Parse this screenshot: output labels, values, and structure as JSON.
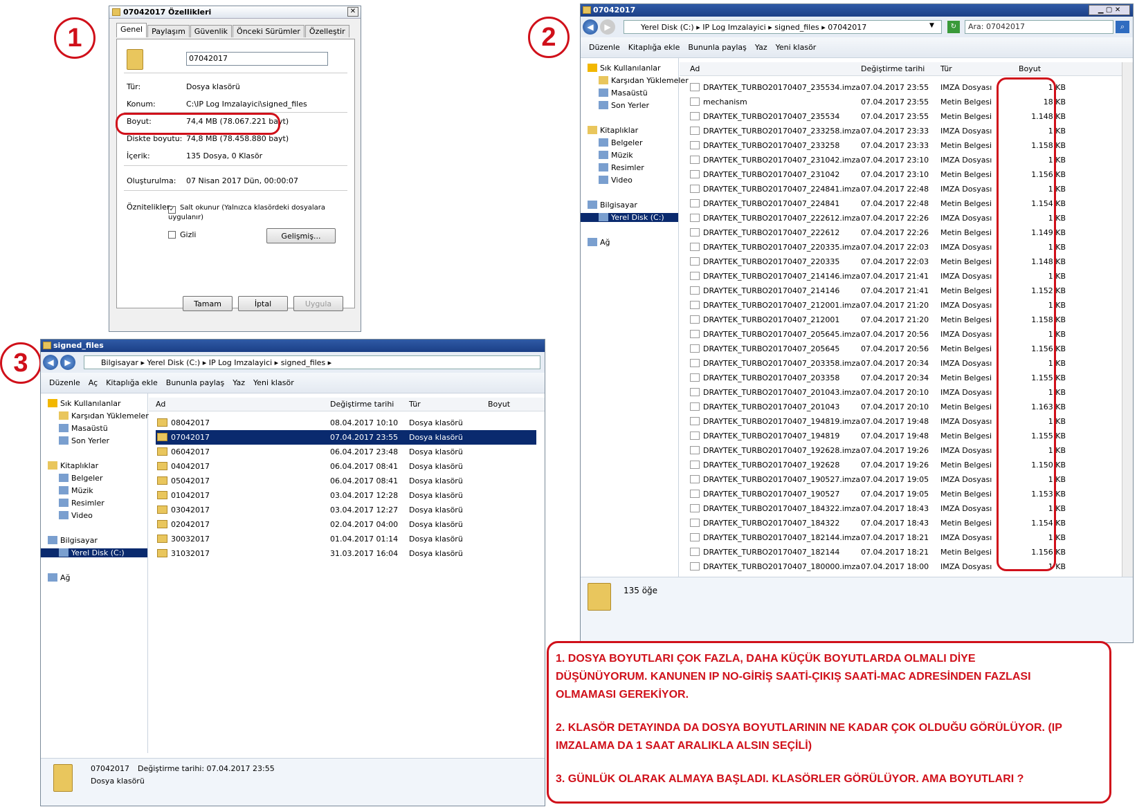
{
  "markers": [
    "1",
    "2",
    "3"
  ],
  "dialog": {
    "title": "07042017 Özellikleri",
    "tabs": [
      "Genel",
      "Paylaşım",
      "Güvenlik",
      "Önceki Sürümler",
      "Özelleştir"
    ],
    "name_value": "07042017",
    "props": [
      {
        "label": "Tür:",
        "value": "Dosya klasörü"
      },
      {
        "label": "Konum:",
        "value": "C:\\IP Log Imzalayici\\signed_files"
      },
      {
        "label": "Boyut:",
        "value": "74,4 MB (78.067.221 bayt)"
      },
      {
        "label": "Diskte boyutu:",
        "value": "74,8 MB (78.458.880 bayt)"
      },
      {
        "label": "İçerik:",
        "value": "135 Dosya, 0 Klasör"
      },
      {
        "label": "Oluşturulma:",
        "value": "07 Nisan 2017 Dün, 00:00:07"
      }
    ],
    "attributes_label": "Öznitelikler:",
    "readonly_label": "Salt okunur (Yalnızca klasördeki dosyalara uygulanır)",
    "hidden_label": "Gizli",
    "advanced_btn": "Gelişmiş...",
    "ok_btn": "Tamam",
    "cancel_btn": "İptal",
    "apply_btn": "Uygula"
  },
  "win2": {
    "title": "07042017",
    "path": [
      "Yerel Disk (C:)",
      "IP Log Imzalayici",
      "signed_files",
      "07042017"
    ],
    "search": "Ara: 07042017",
    "toolbar": [
      "Düzenle",
      "Kitaplığa ekle",
      "Bununla paylaş",
      "Yaz",
      "Yeni klasör"
    ],
    "nav": [
      "Sık Kullanılanlar",
      "Karşıdan Yüklemeler",
      "Masaüstü",
      "Son Yerler",
      "Kitaplıklar",
      "Belgeler",
      "Müzik",
      "Resimler",
      "Video",
      "Bilgisayar",
      "Yerel Disk (C:)",
      "Ağ"
    ],
    "columns": [
      "Ad",
      "Değiştirme tarihi",
      "Tür",
      "Boyut"
    ],
    "rows": [
      [
        "DRAYTEK_TURBO20170407_235534.imza",
        "07.04.2017 23:55",
        "IMZA Dosyası",
        "1 KB"
      ],
      [
        "mechanism",
        "07.04.2017 23:55",
        "Metin Belgesi",
        "18 KB"
      ],
      [
        "DRAYTEK_TURBO20170407_235534",
        "07.04.2017 23:55",
        "Metin Belgesi",
        "1.148 KB"
      ],
      [
        "DRAYTEK_TURBO20170407_233258.imza",
        "07.04.2017 23:33",
        "IMZA Dosyası",
        "1 KB"
      ],
      [
        "DRAYTEK_TURBO20170407_233258",
        "07.04.2017 23:33",
        "Metin Belgesi",
        "1.158 KB"
      ],
      [
        "DRAYTEK_TURBO20170407_231042.imza",
        "07.04.2017 23:10",
        "IMZA Dosyası",
        "1 KB"
      ],
      [
        "DRAYTEK_TURBO20170407_231042",
        "07.04.2017 23:10",
        "Metin Belgesi",
        "1.156 KB"
      ],
      [
        "DRAYTEK_TURBO20170407_224841.imza",
        "07.04.2017 22:48",
        "IMZA Dosyası",
        "1 KB"
      ],
      [
        "DRAYTEK_TURBO20170407_224841",
        "07.04.2017 22:48",
        "Metin Belgesi",
        "1.154 KB"
      ],
      [
        "DRAYTEK_TURBO20170407_222612.imza",
        "07.04.2017 22:26",
        "IMZA Dosyası",
        "1 KB"
      ],
      [
        "DRAYTEK_TURBO20170407_222612",
        "07.04.2017 22:26",
        "Metin Belgesi",
        "1.149 KB"
      ],
      [
        "DRAYTEK_TURBO20170407_220335.imza",
        "07.04.2017 22:03",
        "IMZA Dosyası",
        "1 KB"
      ],
      [
        "DRAYTEK_TURBO20170407_220335",
        "07.04.2017 22:03",
        "Metin Belgesi",
        "1.148 KB"
      ],
      [
        "DRAYTEK_TURBO20170407_214146.imza",
        "07.04.2017 21:41",
        "IMZA Dosyası",
        "1 KB"
      ],
      [
        "DRAYTEK_TURBO20170407_214146",
        "07.04.2017 21:41",
        "Metin Belgesi",
        "1.152 KB"
      ],
      [
        "DRAYTEK_TURBO20170407_212001.imza",
        "07.04.2017 21:20",
        "IMZA Dosyası",
        "1 KB"
      ],
      [
        "DRAYTEK_TURBO20170407_212001",
        "07.04.2017 21:20",
        "Metin Belgesi",
        "1.158 KB"
      ],
      [
        "DRAYTEK_TURBO20170407_205645.imza",
        "07.04.2017 20:56",
        "IMZA Dosyası",
        "1 KB"
      ],
      [
        "DRAYTEK_TURBO20170407_205645",
        "07.04.2017 20:56",
        "Metin Belgesi",
        "1.156 KB"
      ],
      [
        "DRAYTEK_TURBO20170407_203358.imza",
        "07.04.2017 20:34",
        "IMZA Dosyası",
        "1 KB"
      ],
      [
        "DRAYTEK_TURBO20170407_203358",
        "07.04.2017 20:34",
        "Metin Belgesi",
        "1.155 KB"
      ],
      [
        "DRAYTEK_TURBO20170407_201043.imza",
        "07.04.2017 20:10",
        "IMZA Dosyası",
        "1 KB"
      ],
      [
        "DRAYTEK_TURBO20170407_201043",
        "07.04.2017 20:10",
        "Metin Belgesi",
        "1.163 KB"
      ],
      [
        "DRAYTEK_TURBO20170407_194819.imza",
        "07.04.2017 19:48",
        "IMZA Dosyası",
        "1 KB"
      ],
      [
        "DRAYTEK_TURBO20170407_194819",
        "07.04.2017 19:48",
        "Metin Belgesi",
        "1.155 KB"
      ],
      [
        "DRAYTEK_TURBO20170407_192628.imza",
        "07.04.2017 19:26",
        "IMZA Dosyası",
        "1 KB"
      ],
      [
        "DRAYTEK_TURBO20170407_192628",
        "07.04.2017 19:26",
        "Metin Belgesi",
        "1.150 KB"
      ],
      [
        "DRAYTEK_TURBO20170407_190527.imza",
        "07.04.2017 19:05",
        "IMZA Dosyası",
        "1 KB"
      ],
      [
        "DRAYTEK_TURBO20170407_190527",
        "07.04.2017 19:05",
        "Metin Belgesi",
        "1.153 KB"
      ],
      [
        "DRAYTEK_TURBO20170407_184322.imza",
        "07.04.2017 18:43",
        "IMZA Dosyası",
        "1 KB"
      ],
      [
        "DRAYTEK_TURBO20170407_184322",
        "07.04.2017 18:43",
        "Metin Belgesi",
        "1.154 KB"
      ],
      [
        "DRAYTEK_TURBO20170407_182144.imza",
        "07.04.2017 18:21",
        "IMZA Dosyası",
        "1 KB"
      ],
      [
        "DRAYTEK_TURBO20170407_182144",
        "07.04.2017 18:21",
        "Metin Belgesi",
        "1.156 KB"
      ],
      [
        "DRAYTEK_TURBO20170407_180000.imza",
        "07.04.2017 18:00",
        "IMZA Dosyası",
        "1 KB"
      ]
    ],
    "status": "135 öğe"
  },
  "win3": {
    "title": "signed_files",
    "path": [
      "Bilgisayar",
      "Yerel Disk (C:)",
      "IP Log Imzalayici",
      "signed_files"
    ],
    "toolbar": [
      "Düzenle",
      "Aç",
      "Kitaplığa ekle",
      "Bununla paylaş",
      "Yaz",
      "Yeni klasör"
    ],
    "nav": [
      "Sık Kullanılanlar",
      "Karşıdan Yüklemeler",
      "Masaüstü",
      "Son Yerler",
      "Kitaplıklar",
      "Belgeler",
      "Müzik",
      "Resimler",
      "Video",
      "Bilgisayar",
      "Yerel Disk (C:)",
      "Ağ"
    ],
    "columns": [
      "Ad",
      "Değiştirme tarihi",
      "Tür",
      "Boyut"
    ],
    "rows": [
      [
        "08042017",
        "08.04.2017 10:10",
        "Dosya klasörü"
      ],
      [
        "07042017",
        "07.04.2017 23:55",
        "Dosya klasörü"
      ],
      [
        "06042017",
        "06.04.2017 23:48",
        "Dosya klasörü"
      ],
      [
        "04042017",
        "06.04.2017 08:41",
        "Dosya klasörü"
      ],
      [
        "05042017",
        "06.04.2017 08:41",
        "Dosya klasörü"
      ],
      [
        "01042017",
        "03.04.2017 12:28",
        "Dosya klasörü"
      ],
      [
        "03042017",
        "03.04.2017 12:27",
        "Dosya klasörü"
      ],
      [
        "02042017",
        "02.04.2017 04:00",
        "Dosya klasörü"
      ],
      [
        "30032017",
        "01.04.2017 01:14",
        "Dosya klasörü"
      ],
      [
        "31032017",
        "31.03.2017 16:04",
        "Dosya klasörü"
      ]
    ],
    "selected_index": 1,
    "status_name": "07042017",
    "status_date": "Değiştirme tarihi: 07.04.2017 23:55",
    "status_type": "Dosya klasörü"
  },
  "note": {
    "p1a": "1. DOSYA BOYUTLARI ÇOK FAZLA, DAHA KÜÇÜK BOYUTLARDA OLMALI DİYE",
    "p1b": "DÜŞÜNÜYORUM. KANUNEN IP NO-GİRİŞ SAATİ-ÇIKIŞ SAATİ-MAC ADRESİNDEN FAZLASI",
    "p1c": "OLMAMASI GEREKİYOR.",
    "p2a": "2. KLASÖR DETAYINDA DA DOSYA BOYUTLARININ NE KADAR ÇOK OLDUĞU GÖRÜLÜYOR. (IP",
    "p2b": "IMZALAMA DA 1 SAAT ARALIKLA ALSIN SEÇİLİ)",
    "p3": "3. GÜNLÜK OLARAK ALMAYA BAŞLADI. KLASÖRLER GÖRÜLÜYOR. AMA BOYUTLARI ?"
  },
  "colors": {
    "annotation_red": "#d0101a",
    "selection": "#0a2a6e"
  }
}
